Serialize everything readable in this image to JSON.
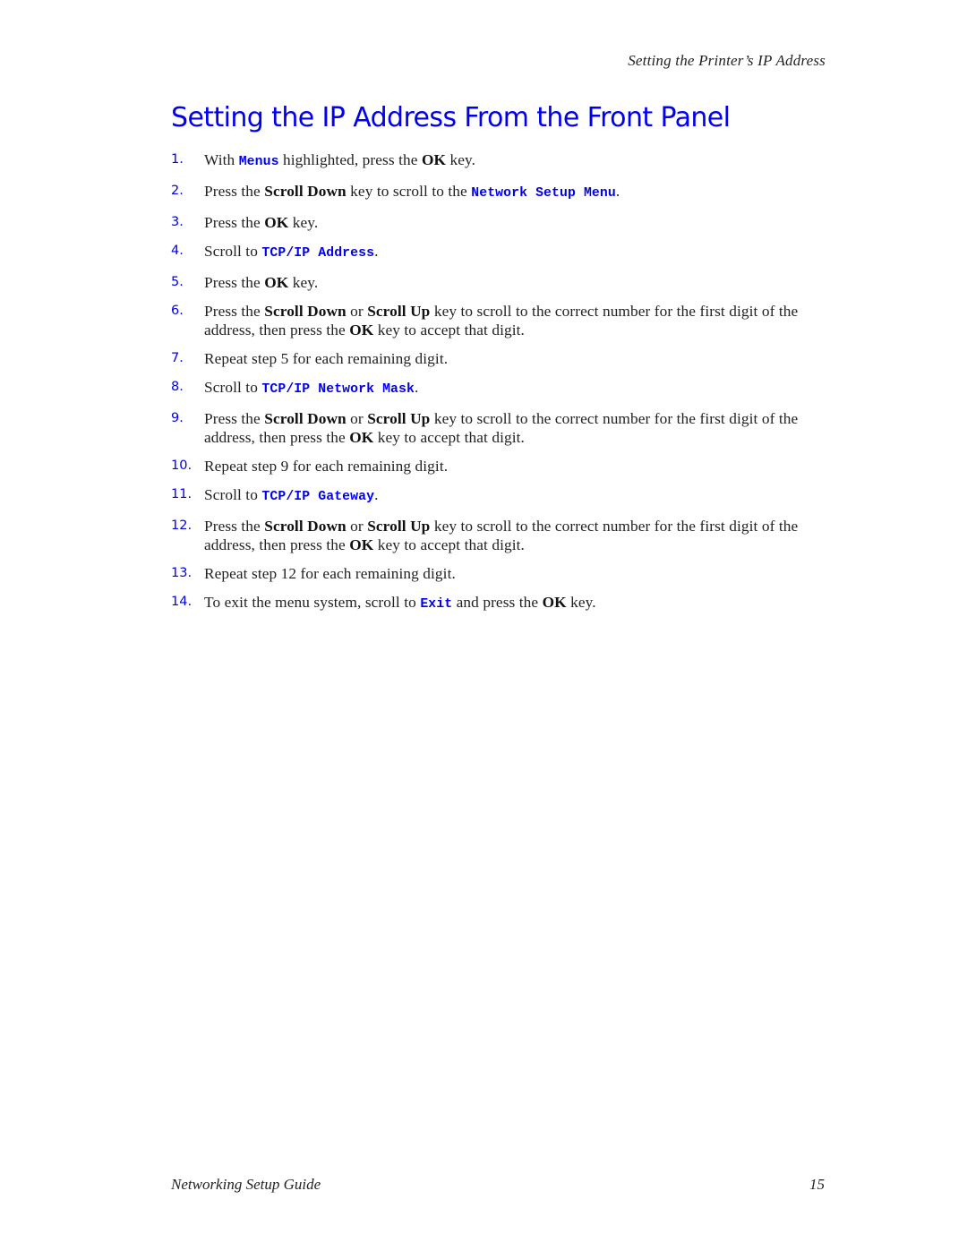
{
  "header": {
    "running_title": "Setting the Printer’s IP Address"
  },
  "page_title": "Setting the IP Address From the Front Panel",
  "accent_color": "#0000ee",
  "steps": [
    {
      "num": "1.",
      "parts": [
        {
          "t": "text",
          "v": "With "
        },
        {
          "t": "code",
          "v": "Menus"
        },
        {
          "t": "text",
          "v": " highlighted, press the "
        },
        {
          "t": "bold",
          "v": "OK"
        },
        {
          "t": "text",
          "v": " key."
        }
      ]
    },
    {
      "num": "2.",
      "parts": [
        {
          "t": "text",
          "v": "Press the "
        },
        {
          "t": "bold",
          "v": "Scroll Down"
        },
        {
          "t": "text",
          "v": " key to scroll to the "
        },
        {
          "t": "code",
          "v": "Network Setup Menu"
        },
        {
          "t": "text",
          "v": "."
        }
      ]
    },
    {
      "num": "3.",
      "parts": [
        {
          "t": "text",
          "v": "Press the "
        },
        {
          "t": "bold",
          "v": "OK"
        },
        {
          "t": "text",
          "v": " key."
        }
      ]
    },
    {
      "num": "4.",
      "parts": [
        {
          "t": "text",
          "v": "Scroll to "
        },
        {
          "t": "code",
          "v": "TCP/IP Address"
        },
        {
          "t": "text",
          "v": "."
        }
      ]
    },
    {
      "num": "5.",
      "parts": [
        {
          "t": "text",
          "v": "Press the "
        },
        {
          "t": "bold",
          "v": "OK"
        },
        {
          "t": "text",
          "v": " key."
        }
      ]
    },
    {
      "num": "6.",
      "parts": [
        {
          "t": "text",
          "v": "Press the "
        },
        {
          "t": "bold",
          "v": "Scroll Down"
        },
        {
          "t": "text",
          "v": " or "
        },
        {
          "t": "bold",
          "v": "Scroll Up"
        },
        {
          "t": "text",
          "v": " key to scroll to the correct number for the first digit of the address, then press the "
        },
        {
          "t": "bold",
          "v": "OK"
        },
        {
          "t": "text",
          "v": " key to accept that digit."
        }
      ]
    },
    {
      "num": "7.",
      "parts": [
        {
          "t": "text",
          "v": "Repeat step 5 for each remaining digit."
        }
      ]
    },
    {
      "num": "8.",
      "parts": [
        {
          "t": "text",
          "v": "Scroll to "
        },
        {
          "t": "code",
          "v": "TCP/IP Network Mask"
        },
        {
          "t": "text",
          "v": "."
        }
      ]
    },
    {
      "num": "9.",
      "parts": [
        {
          "t": "text",
          "v": "Press the "
        },
        {
          "t": "bold",
          "v": "Scroll Down"
        },
        {
          "t": "text",
          "v": " or "
        },
        {
          "t": "bold",
          "v": "Scroll Up"
        },
        {
          "t": "text",
          "v": " key to scroll to the correct number for the first digit of the address, then press the "
        },
        {
          "t": "bold",
          "v": "OK"
        },
        {
          "t": "text",
          "v": " key to accept that digit."
        }
      ]
    },
    {
      "num": "10.",
      "parts": [
        {
          "t": "text",
          "v": "Repeat step 9 for each remaining digit."
        }
      ]
    },
    {
      "num": "11.",
      "parts": [
        {
          "t": "text",
          "v": "Scroll to "
        },
        {
          "t": "code",
          "v": "TCP/IP Gateway"
        },
        {
          "t": "text",
          "v": "."
        }
      ]
    },
    {
      "num": "12.",
      "parts": [
        {
          "t": "text",
          "v": "Press the "
        },
        {
          "t": "bold",
          "v": "Scroll Down"
        },
        {
          "t": "text",
          "v": " or "
        },
        {
          "t": "bold",
          "v": "Scroll Up"
        },
        {
          "t": "text",
          "v": " key to scroll to the correct number for the first digit of the address, then press the "
        },
        {
          "t": "bold",
          "v": "OK"
        },
        {
          "t": "text",
          "v": " key to accept that digit."
        }
      ]
    },
    {
      "num": "13.",
      "parts": [
        {
          "t": "text",
          "v": "Repeat step 12 for each remaining digit."
        }
      ]
    },
    {
      "num": "14.",
      "parts": [
        {
          "t": "text",
          "v": "To exit the menu system, scroll to "
        },
        {
          "t": "code",
          "v": "Exit"
        },
        {
          "t": "text",
          "v": " and press the "
        },
        {
          "t": "bold",
          "v": "OK"
        },
        {
          "t": "text",
          "v": " key."
        }
      ]
    }
  ],
  "footer": {
    "guide_title": "Networking Setup Guide",
    "page_number": "15"
  }
}
